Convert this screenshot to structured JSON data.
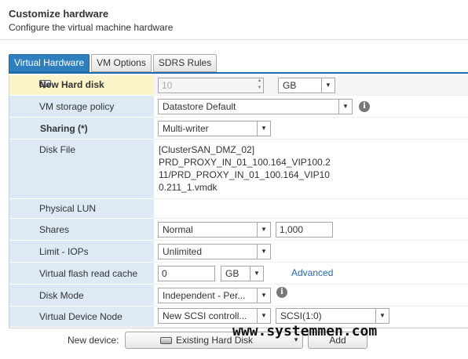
{
  "header": {
    "title": "Customize hardware",
    "subtitle": "Configure the virtual machine hardware"
  },
  "tabs": [
    {
      "label": "Virtual Hardware",
      "active": true
    },
    {
      "label": "VM Options",
      "active": false
    },
    {
      "label": "SDRS Rules",
      "active": false
    }
  ],
  "disk": {
    "title": "New Hard disk",
    "size_value": "10",
    "size_unit": "GB",
    "rows": {
      "storage_policy": {
        "label": "VM storage policy",
        "value": "Datastore Default"
      },
      "sharing": {
        "label": "Sharing (*)",
        "value": "Multi-writer"
      },
      "disk_file": {
        "label": "Disk File",
        "lines": [
          "[ClusterSAN_DMZ_02]",
          "PRD_PROXY_IN_01_100.164_VIP100.2",
          "11/PRD_PROXY_IN_01_100.164_VIP10",
          "0.211_1.vmdk"
        ]
      },
      "physical_lun": {
        "label": "Physical LUN"
      },
      "shares": {
        "label": "Shares",
        "value": "Normal",
        "amount": "1,000"
      },
      "limit_iops": {
        "label": "Limit - IOPs",
        "value": "Unlimited"
      },
      "flash_cache": {
        "label": "Virtual flash read cache",
        "value": "0",
        "unit": "GB",
        "advanced": "Advanced"
      },
      "disk_mode": {
        "label": "Disk Mode",
        "value": "Independent - Per..."
      },
      "device_node": {
        "label": "Virtual Device Node",
        "controller": "New SCSI controll...",
        "slot": "SCSI(1:0)"
      }
    }
  },
  "footer": {
    "new_device_label": "New device:",
    "new_device_value": "Existing Hard Disk",
    "add_label": "Add"
  },
  "watermark": "www.systemmen.com",
  "colors": {
    "tab_active": "#2f7fbf",
    "label_bg": "#dde9f5",
    "header_row_bg": "#fbf4c8",
    "link": "#2866a8"
  }
}
